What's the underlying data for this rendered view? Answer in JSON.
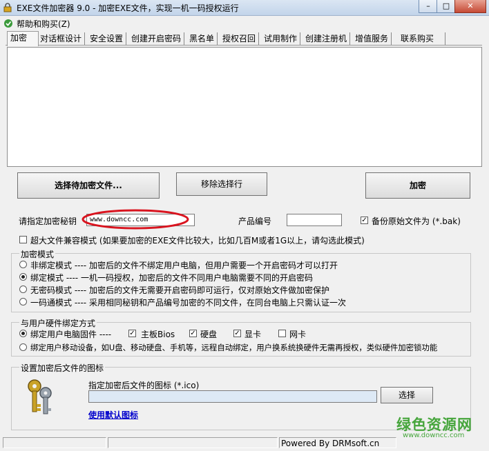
{
  "window": {
    "title": "EXE文件加密器 9.0 - 加密EXE文件，实现一机一码授权运行",
    "minimize": "–",
    "maximize": "□",
    "close": "✕"
  },
  "menu": {
    "help": "帮助和购买(Z)"
  },
  "tabs": [
    "加密",
    "对话框设计",
    "安全设置",
    "创建开启密码",
    "黑名单",
    "授权召回",
    "试用制作",
    "创建注册机",
    "增值服务",
    "联系购买"
  ],
  "buttons": {
    "select_file": "选择待加密文件...",
    "remove_selected": "移除选择行",
    "encrypt": "加密",
    "choose_icon": "选择"
  },
  "key": {
    "label": "请指定加密秘钥",
    "value": "www.downcc.com",
    "product_label": "产品编号",
    "product_value": "",
    "backup_label": "备份原始文件为 (*.bak)",
    "backup_checked": true
  },
  "large_file": {
    "label": "超大文件兼容模式 (如果要加密的EXE文件比较大，比如几百M或者1G以上，请勾选此模式)",
    "checked": false
  },
  "mode_group": {
    "title": "加密模式",
    "options": [
      {
        "label": "非绑定模式 ---- 加密后的文件不绑定用户电脑，但用户需要一个开启密码才可以打开",
        "selected": false
      },
      {
        "label": "绑定模式 ---- 一机一码授权，加密后的文件不同用户电脑需要不同的开启密码",
        "selected": true
      },
      {
        "label": "无密码模式 ---- 加密后的文件无需要开启密码即可运行，仅对原始文件做加密保护",
        "selected": false
      },
      {
        "label": "一码通模式 ---- 采用相同秘钥和产品编号加密的不同文件，在同台电脑上只需认证一次",
        "selected": false
      }
    ]
  },
  "hw_group": {
    "title": "与用户硬件绑定方式",
    "fixed_label": "绑定用户电脑固件 ----",
    "fixed_selected": true,
    "checks": [
      {
        "label": "主板Bios",
        "checked": true
      },
      {
        "label": "硬盘",
        "checked": true
      },
      {
        "label": "显卡",
        "checked": true
      },
      {
        "label": "网卡",
        "checked": false
      }
    ],
    "mobile_label": "绑定用户移动设备，如U盘、移动硬盘、手机等，远程自动绑定，用户换系统换硬件无需再授权，类似硬件加密锁功能",
    "mobile_selected": false
  },
  "icon_group": {
    "title": "设置加密后文件的图标",
    "path_label": "指定加密后文件的图标 (*.ico)",
    "path_value": "",
    "default_link": "使用默认图标"
  },
  "status": {
    "powered": "Powered By DRMsoft.cn"
  },
  "watermark": {
    "text": "绿色资源网",
    "url": "www.downcc.com"
  },
  "colors": {
    "highlight_ellipse": "#d9141f",
    "watermark_green": "#46a53c",
    "link": "#0000cc"
  }
}
